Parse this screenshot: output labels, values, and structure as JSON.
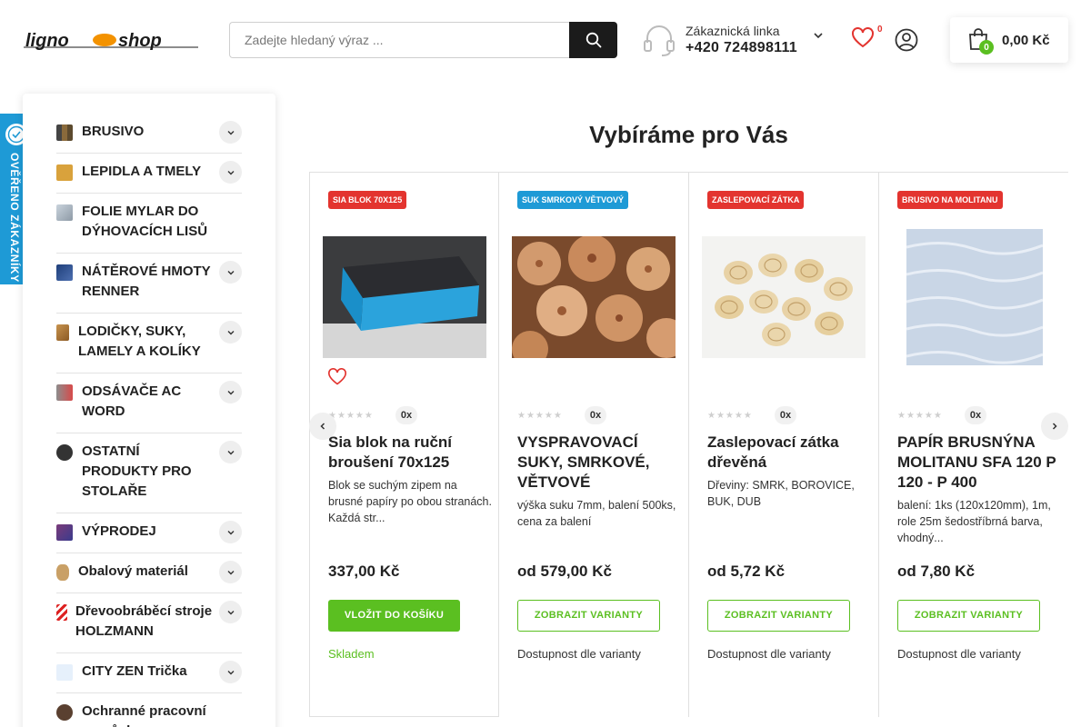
{
  "header": {
    "logo_text": "lignoshop",
    "search": {
      "placeholder": "Zadejte hledaný výraz ..."
    },
    "hotline": {
      "label": "Zákaznická linka",
      "phone": "+420 724898111"
    },
    "wishlist_count": "0",
    "cart": {
      "count": "0",
      "total": "0,00 Kč"
    }
  },
  "verified_badge": {
    "text": "OVĚŘENO ZÁKAZNÍKY"
  },
  "sidebar": {
    "categories": [
      {
        "label": "BRUSIVO",
        "icon": "sandpaper-icon"
      },
      {
        "label": "LEPIDLA A TMELY",
        "icon": "glue-icon"
      },
      {
        "label": "FOLIE MYLAR DO DÝHOVACÍCH LISŮ",
        "icon": "foil-icon"
      },
      {
        "label": "NÁTĚROVÉ HMOTY RENNER",
        "icon": "paint-icon"
      },
      {
        "label": "LODIČKY, SUKY, LAMELY A KOLÍKY",
        "icon": "dowel-icon"
      },
      {
        "label": "ODSÁVAČE AC WORD",
        "icon": "extractor-icon"
      },
      {
        "label": "OSTATNÍ PRODUKTY PRO STOLAŘE",
        "icon": "tools-icon"
      },
      {
        "label": "VÝPRODEJ",
        "icon": "sale-icon"
      },
      {
        "label": "Obalový materiál",
        "icon": "packaging-icon"
      },
      {
        "label": "Dřevoobráběcí stroje HOLZMANN",
        "icon": "machine-icon"
      },
      {
        "label": "CITY ZEN Trička",
        "icon": "tshirt-icon"
      },
      {
        "label": "Ochranné pracovní pomůcky",
        "icon": "protective-gear-icon"
      }
    ]
  },
  "main": {
    "title": "Vybíráme pro Vás",
    "products": [
      {
        "tag": "SIA BLOK 70X125",
        "tag_color": "#e3342f",
        "rating_count": "0x",
        "name": "Sia blok na ruční broušení 70x125",
        "description": "Blok se suchým zipem na brusné papíry po obou stranách. Každá str...",
        "price": "337,00 Kč",
        "button": "VLOŽIT DO KOŠÍKU",
        "availability": "Skladem",
        "availability_color": "#5bbf21"
      },
      {
        "tag": "SUK SMRKOVÝ VĚTVOVÝ",
        "tag_color": "#1e9ad6",
        "rating_count": "0x",
        "name": "VYSPRAVOVACÍ SUKY, SMRKOVÉ, VĚTVOVÉ",
        "description": "výška suku 7mm, balení 500ks, cena za balení",
        "price": "od 579,00 Kč",
        "button": "ZOBRAZIT VARIANTY",
        "availability": "Dostupnost dle varianty",
        "availability_color": "#333333"
      },
      {
        "tag": "ZASLEPOVACÍ ZÁTKA",
        "tag_color": "#e3342f",
        "rating_count": "0x",
        "name": "Zaslepovací zátka dřevěná",
        "description": "Dřeviny: SMRK, BOROVICE, BUK, DUB",
        "price": "od 5,72 Kč",
        "button": "ZOBRAZIT VARIANTY",
        "availability": "Dostupnost dle varianty",
        "availability_color": "#333333"
      },
      {
        "tag": "BRUSIVO NA MOLITANU",
        "tag_color": "#e3342f",
        "rating_count": "0x",
        "name": "PAPÍR BRUSNÝNA MOLITANU SFA 120 P 120 - P 400",
        "description": "balení: 1ks (120x120mm), 1m, role 25m šedostříbrná barva, vhodný...",
        "price": "od 7,80 Kč",
        "button": "ZOBRAZIT VARIANTY",
        "availability": "Dostupnost dle varianty",
        "availability_color": "#333333"
      }
    ]
  }
}
